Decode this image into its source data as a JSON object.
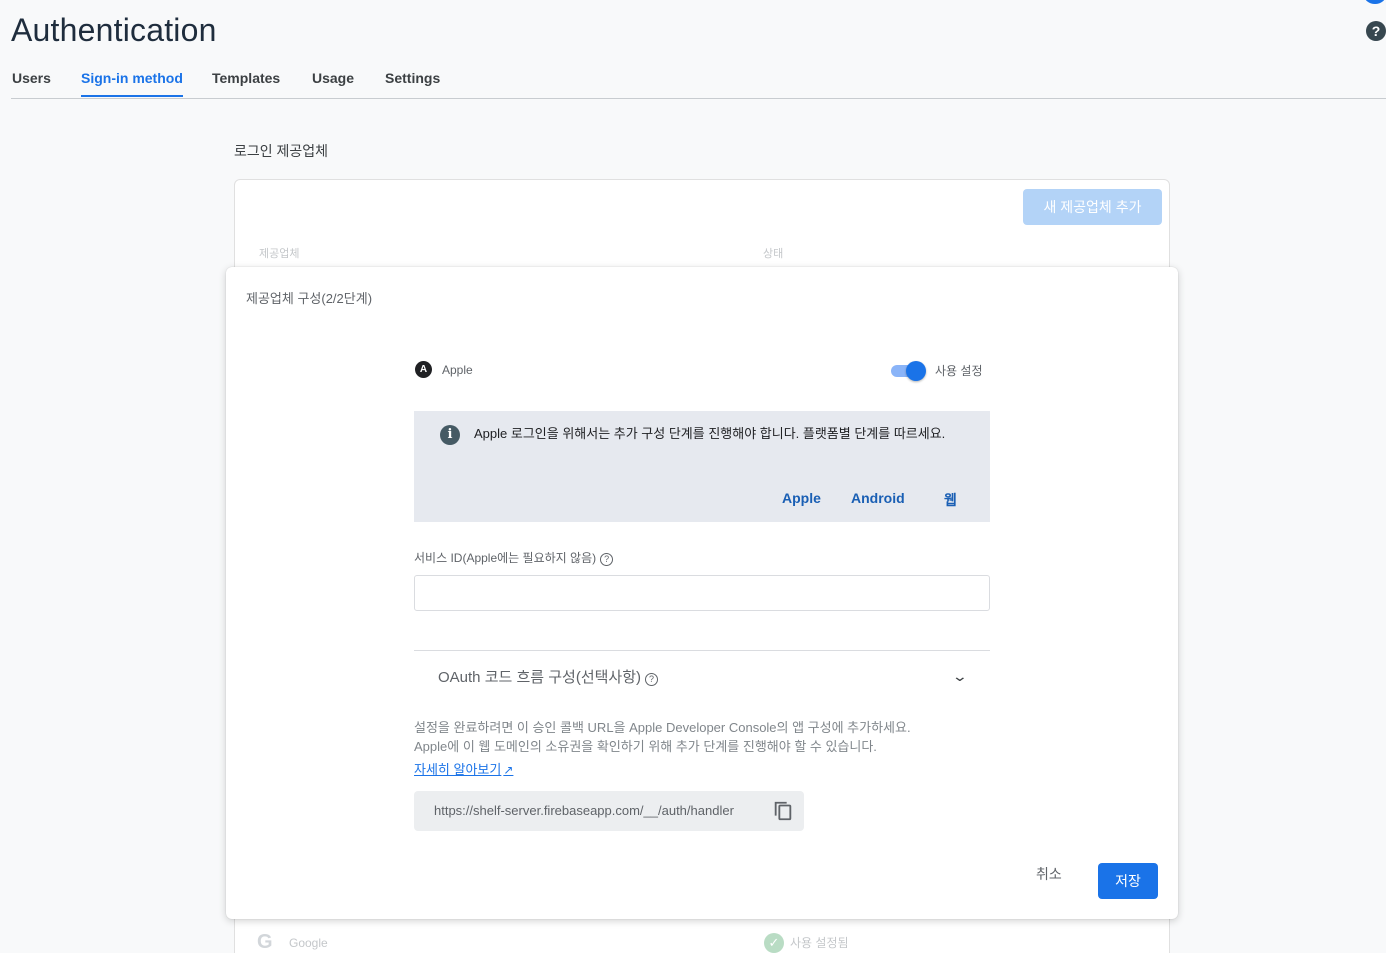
{
  "header": {
    "title": "Authentication",
    "help_icon": "?"
  },
  "tabs": [
    {
      "label": "Users",
      "active": false
    },
    {
      "label": "Sign-in method",
      "active": true
    },
    {
      "label": "Templates",
      "active": false
    },
    {
      "label": "Usage",
      "active": false
    },
    {
      "label": "Settings",
      "active": false
    }
  ],
  "providers_section": {
    "title": "로그인 제공업체",
    "add_button": "새 제공업체 추가",
    "col_provider": "제공업체",
    "col_status": "상태",
    "rows": [
      {
        "icon": "google-icon",
        "name": "Google",
        "status": "사용 설정됨"
      }
    ]
  },
  "modal": {
    "title": "제공업체 구성(2/2단계)",
    "provider": {
      "icon_letter": "A",
      "name": "Apple"
    },
    "toggle": {
      "label": "사용 설정",
      "enabled": true
    },
    "info": {
      "text": "Apple 로그인을 위해서는 추가 구성 단계를 진행해야 합니다. 플랫폼별 단계를 따르세요.",
      "links": [
        "Apple",
        "Android",
        "웹"
      ]
    },
    "service_id": {
      "label": "서비스 ID(Apple에는 필요하지 않음)",
      "value": "",
      "placeholder": ""
    },
    "oauth": {
      "label": "OAuth 코드 흐름 구성(선택사항)"
    },
    "description": {
      "line1": "설정을 완료하려면 이 승인 콜백 URL을 Apple Developer Console의 앱 구성에 추가하세요.",
      "line2": "Apple에 이 웹 도메인의 소유권을 확인하기 위해 추가 단계를 진행해야 할 수 있습니다.",
      "learn_more": "자세히 알아보기"
    },
    "callback_url": "https://shelf-server.firebaseapp.com/__/auth/handler",
    "cancel_button": "취소",
    "save_button": "저장"
  },
  "colors": {
    "accent": "#1a73e8",
    "info_bg": "#e6e9ef",
    "disabled_button": "#b3d3f7"
  }
}
